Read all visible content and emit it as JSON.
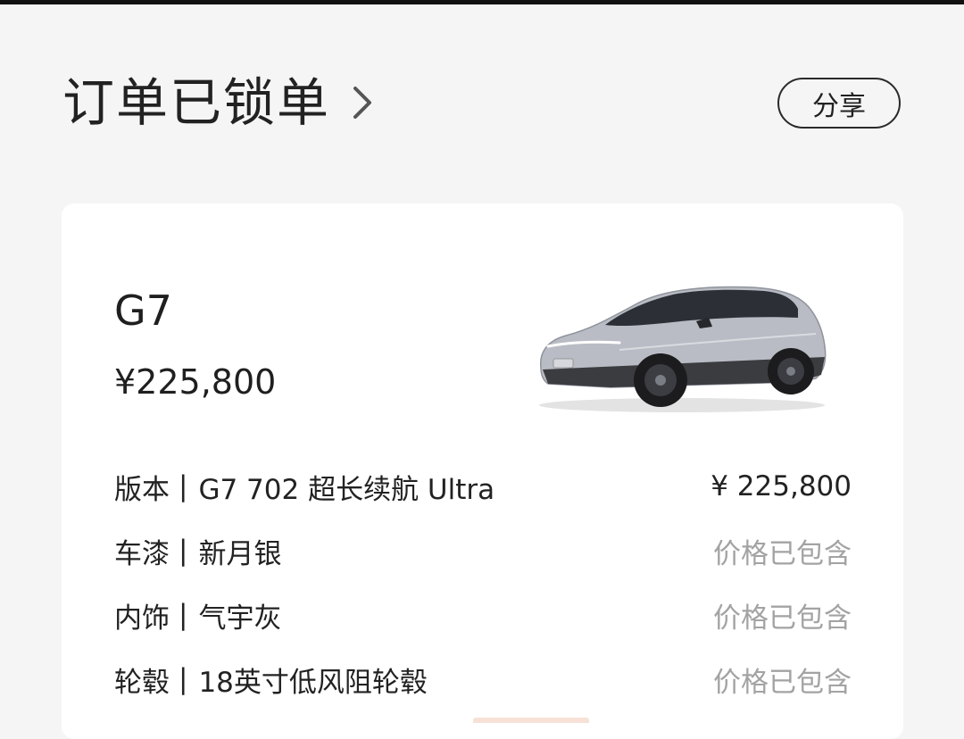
{
  "header": {
    "title": "订单已锁单",
    "chevron_icon": "chevron-right-icon"
  },
  "share": {
    "label": "分享"
  },
  "card": {
    "model": "G7",
    "price": "¥225,800",
    "car_image": "silver-suv-image",
    "specs": [
      {
        "label": "版本",
        "separator": "|",
        "value": "G7 702 超长续航 Ultra",
        "price": "¥ 225,800",
        "muted": false
      },
      {
        "label": "车漆",
        "separator": "|",
        "value": "新月银",
        "price": "价格已包含",
        "muted": true
      },
      {
        "label": "内饰",
        "separator": "|",
        "value": "气宇灰",
        "price": "价格已包含",
        "muted": true
      },
      {
        "label": "轮毂",
        "separator": "|",
        "value": "18英寸低风阻轮毂",
        "price": "价格已包含",
        "muted": true
      }
    ]
  },
  "colors": {
    "background": "#f5f5f5",
    "card": "#ffffff",
    "text": "#1f1f1f",
    "muted": "#a3a3a3"
  }
}
